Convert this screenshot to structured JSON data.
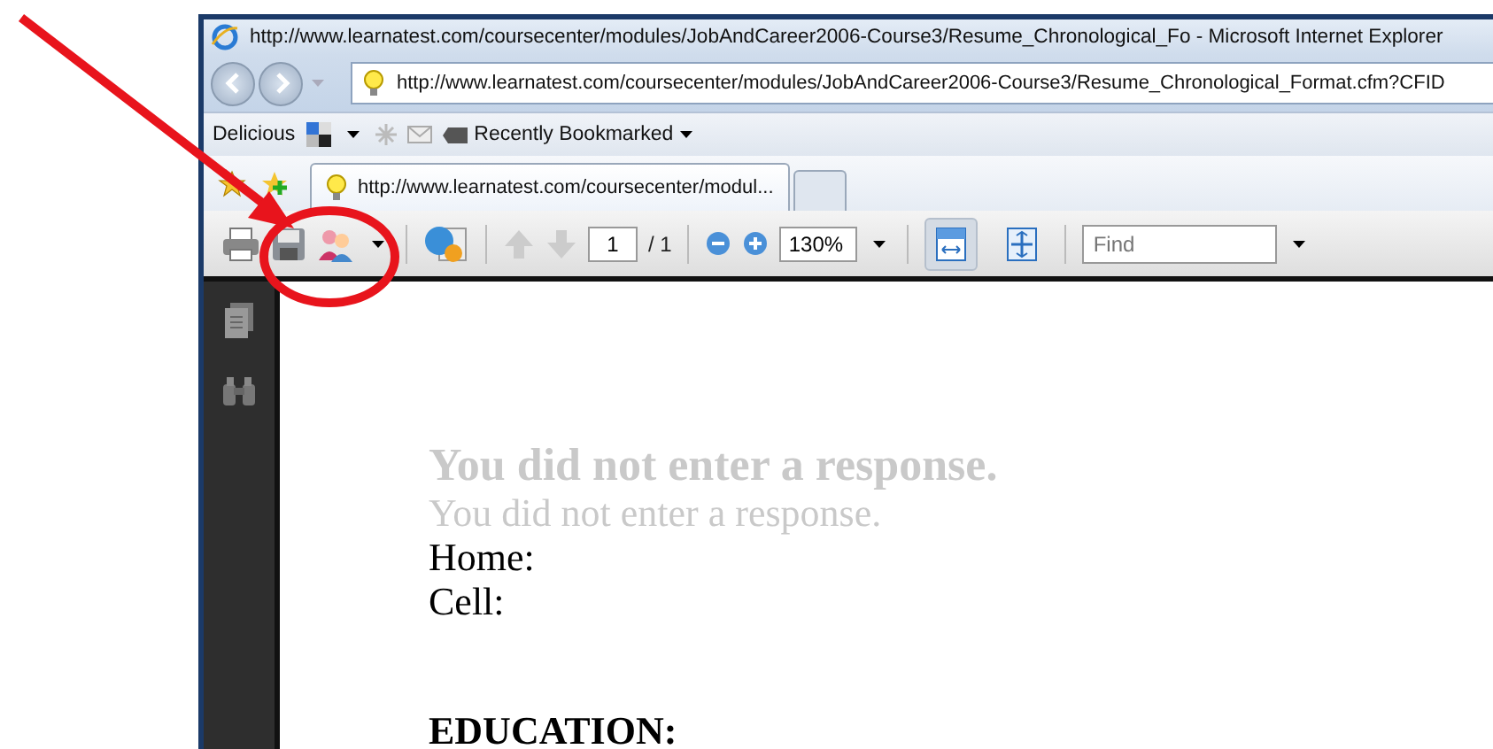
{
  "window": {
    "title": "http://www.learnatest.com/coursecenter/modules/JobAndCareer2006-Course3/Resume_Chronological_Fo - Microsoft Internet Explorer"
  },
  "address_bar": {
    "value": "http://www.learnatest.com/coursecenter/modules/JobAndCareer2006-Course3/Resume_Chronological_Format.cfm?CFID"
  },
  "links_bar": {
    "delicious": "Delicious",
    "bookmarks": "Recently Bookmarked"
  },
  "tabs": [
    {
      "label": "http://www.learnatest.com/coursecenter/modul...",
      "selected": true
    },
    {
      "selected": false
    }
  ],
  "pdf_toolbar": {
    "page": "1",
    "page_count": "/ 1",
    "zoom": "130%",
    "find_placeholder": "Find",
    "view_buttons": [
      {
        "selected": true
      },
      {
        "selected": false
      }
    ]
  },
  "document": {
    "lines": [
      {
        "kind": "placeholder-bold",
        "text": "You did not enter a response."
      },
      {
        "kind": "placeholder",
        "text": "You did not enter a response."
      },
      {
        "kind": "label",
        "text": "Home:"
      },
      {
        "kind": "label",
        "text": "Cell:"
      },
      {
        "kind": "section",
        "text": "EDUCATION:"
      }
    ]
  }
}
